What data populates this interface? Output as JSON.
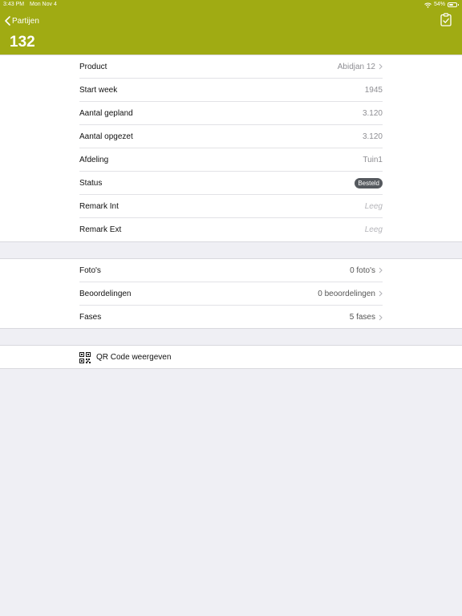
{
  "status_bar": {
    "time": "3:43 PM",
    "date": "Mon Nov 4",
    "battery": "54%"
  },
  "nav": {
    "back_label": "Partijen",
    "title": "132"
  },
  "details": [
    {
      "label": "Product",
      "value": "Abidjan 12",
      "chevron": true
    },
    {
      "label": "Start week",
      "value": "1945"
    },
    {
      "label": "Aantal gepland",
      "value": "3.120"
    },
    {
      "label": "Aantal opgezet",
      "value": "3.120"
    },
    {
      "label": "Afdeling",
      "value": "Tuin1"
    },
    {
      "label": "Status",
      "value": "Besteld",
      "badge": true
    },
    {
      "label": "Remark Int",
      "value": "Leeg",
      "placeholder": true
    },
    {
      "label": "Remark Ext",
      "value": "Leeg",
      "placeholder": true
    }
  ],
  "links": [
    {
      "label": "Foto's",
      "value": "0 foto's"
    },
    {
      "label": "Beoordelingen",
      "value": "0 beoordelingen"
    },
    {
      "label": "Fases",
      "value": "5 fases"
    }
  ],
  "qr": {
    "label": "QR Code weergeven"
  },
  "colors": {
    "accent": "#a0ab13",
    "background": "#efeff4",
    "badge": "#55595e"
  }
}
